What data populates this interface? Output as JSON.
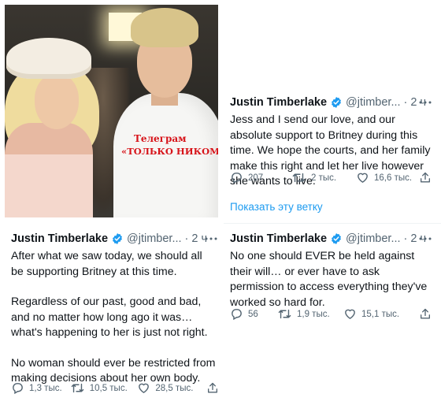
{
  "photo": {
    "overlay_line1": "Телеграм",
    "overlay_line2": "«ТОЛЬКО НИКОМУ»"
  },
  "colors": {
    "link": "#1d9bf0",
    "verified": "#1d9bf0",
    "overlay_text": "#d7141a",
    "secondary_text": "#536471"
  },
  "tweets": [
    {
      "author": "Justin Timberlake",
      "handle": "@jtimber...",
      "dot": "·",
      "time": "2 ч",
      "paragraphs": [
        "Jess and I send our love, and our absolute support to Britney during this time. We hope the courts, and her family make this right and let her live however she wants to live."
      ],
      "replies": "207",
      "retweets": "2 тыс.",
      "likes": "16,6 тыс.",
      "show_thread": "Показать эту ветку"
    },
    {
      "author": "Justin Timberlake",
      "handle": "@jtimber...",
      "dot": "·",
      "time": "2 ч",
      "paragraphs": [
        "After what we saw today, we should all be supporting Britney at this time.",
        "Regardless of our past, good and bad, and no matter how long ago it was… what's happening to her is just not right.",
        "No woman should ever be restricted from making decisions about her own body."
      ],
      "replies": "1,3 тыс.",
      "retweets": "10,5 тыс.",
      "likes": "28,5 тыс."
    },
    {
      "author": "Justin Timberlake",
      "handle": "@jtimber...",
      "dot": "·",
      "time": "2 ч",
      "paragraphs": [
        "No one should EVER be held against their will… or ever have to ask permission to access everything they've worked so hard for."
      ],
      "replies": "56",
      "retweets": "1,9 тыс.",
      "likes": "15,1 тыс."
    }
  ]
}
